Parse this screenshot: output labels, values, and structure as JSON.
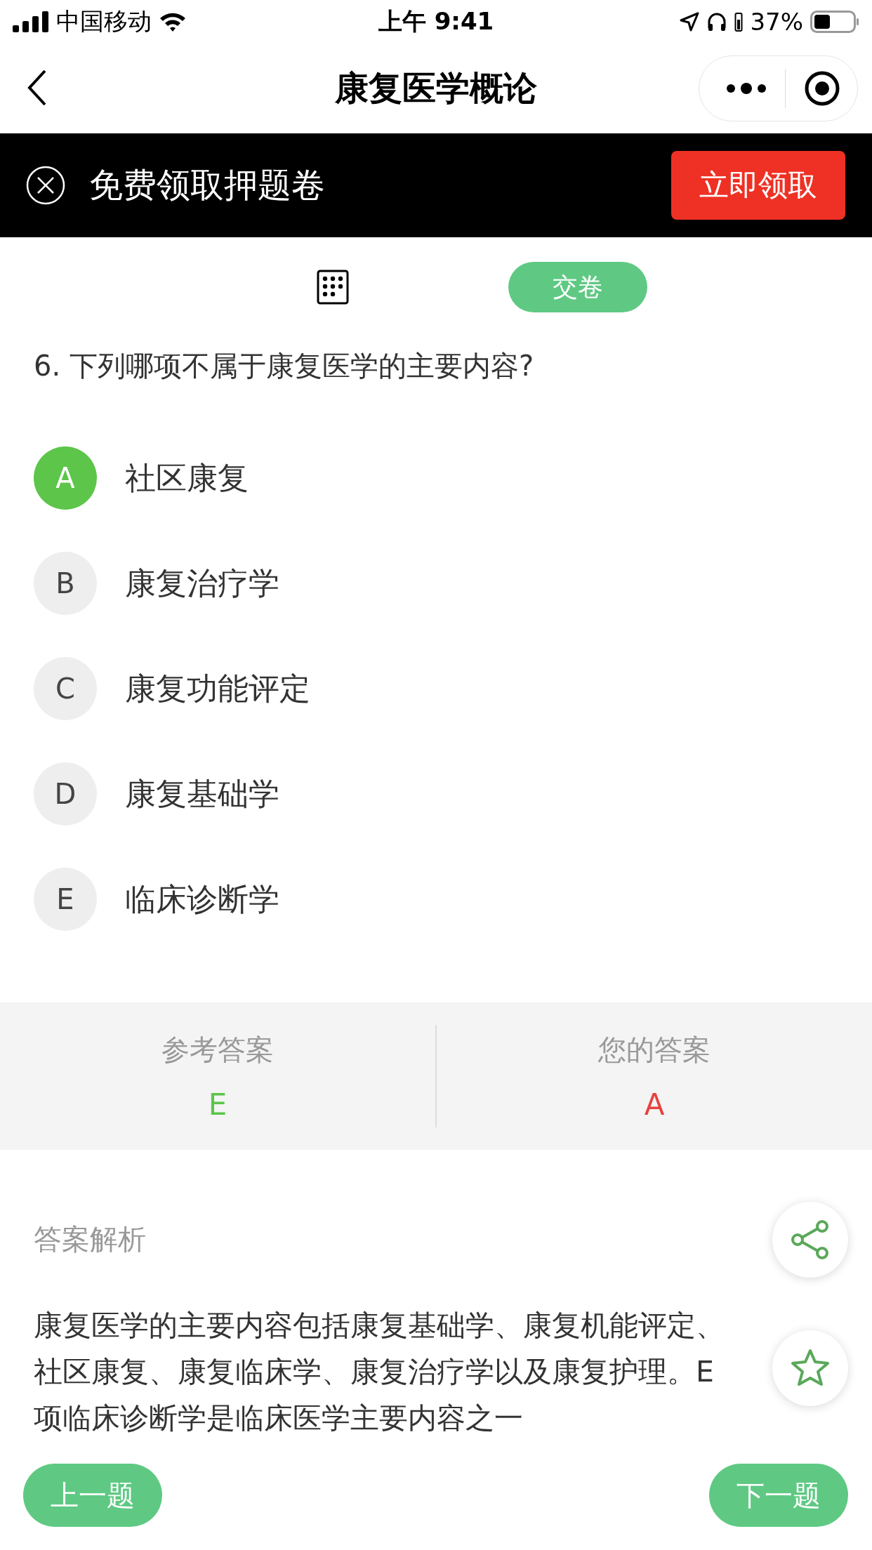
{
  "status_bar": {
    "carrier": "中国移动",
    "time": "上午 9:41",
    "battery": "37%"
  },
  "nav": {
    "title": "康复医学概论"
  },
  "promo": {
    "text": "免费领取押题卷",
    "button": "立即领取"
  },
  "toolbar": {
    "submit": "交卷"
  },
  "question": {
    "text": "6. 下列哪项不属于康复医学的主要内容?"
  },
  "options": [
    {
      "letter": "A",
      "text": "社区康复",
      "selected": true
    },
    {
      "letter": "B",
      "text": "康复治疗学",
      "selected": false
    },
    {
      "letter": "C",
      "text": "康复功能评定",
      "selected": false
    },
    {
      "letter": "D",
      "text": "康复基础学",
      "selected": false
    },
    {
      "letter": "E",
      "text": "临床诊断学",
      "selected": false
    }
  ],
  "answers": [
    {
      "label": "参考答案",
      "value": "E",
      "correct": true
    },
    {
      "label": "您的答案",
      "value": "A",
      "correct": false
    }
  ],
  "analysis": {
    "heading": "答案解析",
    "text": "康复医学的主要内容包括康复基础学、康复机能评定、社区康复、康复临床学、康复治疗学以及康复护理。E项临床诊断学是临床医学主要内容之一"
  },
  "nav_buttons": {
    "prev": "上一题",
    "next": "下一题"
  }
}
